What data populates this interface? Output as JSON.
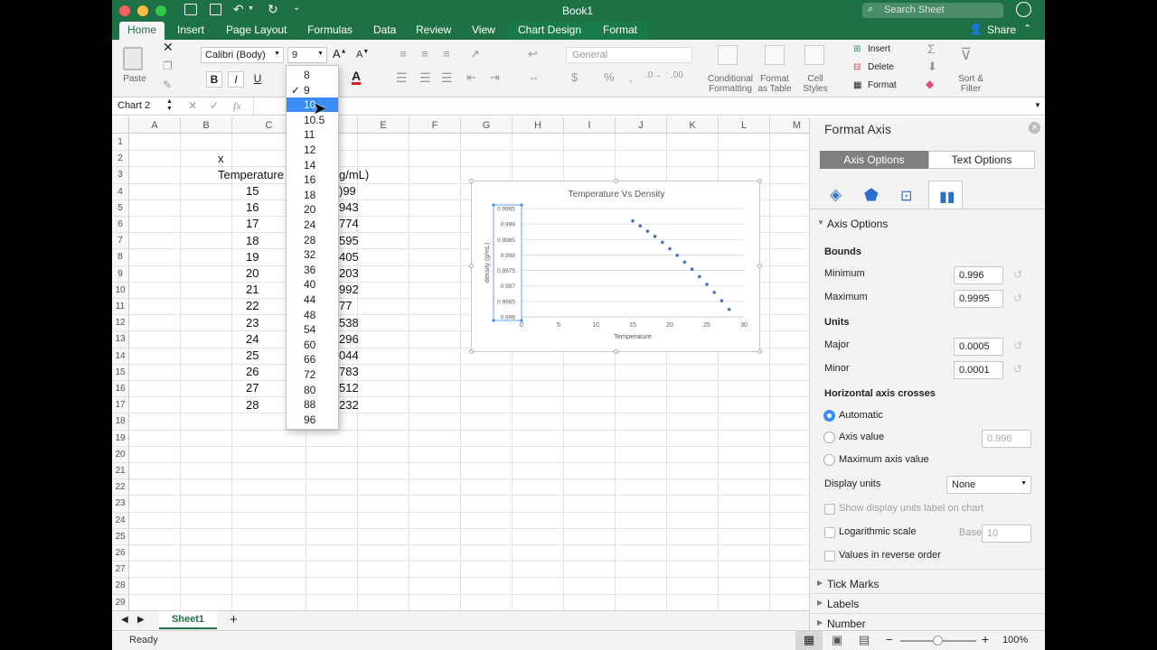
{
  "app": {
    "title": "Book1",
    "search_placeholder": "Search Sheet",
    "share": "Share"
  },
  "tabs": [
    "Home",
    "Insert",
    "Page Layout",
    "Formulas",
    "Data",
    "Review",
    "View",
    "Chart Design",
    "Format"
  ],
  "ribbon": {
    "paste": "Paste",
    "font_name": "Calibri (Body)",
    "font_size": "9",
    "number_format": "General",
    "conditional_formatting": [
      "Conditional",
      "Formatting"
    ],
    "format_as_table": [
      "Format",
      "as Table"
    ],
    "cell_styles": [
      "Cell",
      "Styles"
    ],
    "insert": "Insert",
    "delete": "Delete",
    "format": "Format",
    "sort_filter": [
      "Sort &",
      "Filter"
    ]
  },
  "formula_bar": {
    "name_box": "Chart 2",
    "fx": "fx"
  },
  "columns": [
    "A",
    "B",
    "C",
    "D",
    "E",
    "F",
    "G",
    "H",
    "I",
    "J",
    "K",
    "L",
    "M"
  ],
  "rows": [
    "1",
    "2",
    "3",
    "4",
    "5",
    "6",
    "7",
    "8",
    "9",
    "10",
    "11",
    "12",
    "13",
    "14",
    "15",
    "16",
    "17",
    "18",
    "19",
    "20",
    "21",
    "22",
    "23",
    "24",
    "25",
    "26",
    "27",
    "28",
    "29"
  ],
  "cells": {
    "c2": "x",
    "c3": "Temperature",
    "d3": "g/mL)",
    "temps": [
      "15",
      "16",
      "17",
      "18",
      "19",
      "20",
      "21",
      "22",
      "23",
      "24",
      "25",
      "26",
      "27",
      "28"
    ],
    "densities": [
      ")99",
      "943",
      "774",
      "595",
      "405",
      "203",
      "992",
      "77",
      "538",
      "296",
      "044",
      "783",
      "512",
      "232"
    ]
  },
  "font_size_menu": {
    "items": [
      "8",
      "9",
      "10",
      "10.5",
      "11",
      "12",
      "14",
      "16",
      "18",
      "20",
      "24",
      "28",
      "32",
      "36",
      "40",
      "44",
      "48",
      "54",
      "60",
      "66",
      "72",
      "80",
      "88",
      "96"
    ],
    "checked": "9",
    "highlighted": "10",
    "check_mark": "✓"
  },
  "sheet_tabs": {
    "active": "Sheet1",
    "add": "+"
  },
  "status": {
    "ready": "Ready",
    "zoom": "100%"
  },
  "chart_data": {
    "type": "scatter",
    "title": "Temperature Vs Density",
    "xlabel": "Temperature",
    "ylabel": "density (g/mL)",
    "xlim": [
      0,
      30
    ],
    "ylim": [
      0.996,
      0.9995
    ],
    "xticks": [
      "0",
      "5",
      "10",
      "15",
      "20",
      "25",
      "30"
    ],
    "yticks": [
      "0.996",
      "0.9965",
      "0.997",
      "0.9975",
      "0.998",
      "0.9985",
      "0.999",
      "0.9995"
    ],
    "grid": true,
    "color": "#4472c4",
    "x": [
      15,
      16,
      17,
      18,
      19,
      20,
      21,
      22,
      23,
      24,
      25,
      26,
      27,
      28
    ],
    "y": [
      0.9991,
      0.99894,
      0.99877,
      0.9986,
      0.99841,
      0.9982,
      0.99799,
      0.99777,
      0.99754,
      0.9973,
      0.99705,
      0.99679,
      0.99652,
      0.99624
    ]
  },
  "format_pane": {
    "title": "Format Axis",
    "tab_axis": "Axis Options",
    "tab_text": "Text Options",
    "section": "Axis Options",
    "bounds": "Bounds",
    "minimum_label": "Minimum",
    "minimum": "0.996",
    "maximum_label": "Maximum",
    "maximum": "0.9995",
    "units": "Units",
    "major_label": "Major",
    "major": "0.0005",
    "minor_label": "Minor",
    "minor": "0.0001",
    "crosses": "Horizontal axis crosses",
    "automatic": "Automatic",
    "axis_value": "Axis value",
    "axis_value_input": "0.996",
    "max_axis_value": "Maximum axis value",
    "display_units": "Display units",
    "display_units_value": "None",
    "show_units_label": "Show display units label on chart",
    "log_scale": "Logarithmic scale",
    "base_label": "Base",
    "base_value": "10",
    "reverse": "Values in reverse order",
    "tick_marks": "Tick Marks",
    "labels": "Labels",
    "number": "Number"
  },
  "colors": {
    "excel_green": "#1e7145",
    "selection": "#3b8df6",
    "series": "#4472c4"
  }
}
